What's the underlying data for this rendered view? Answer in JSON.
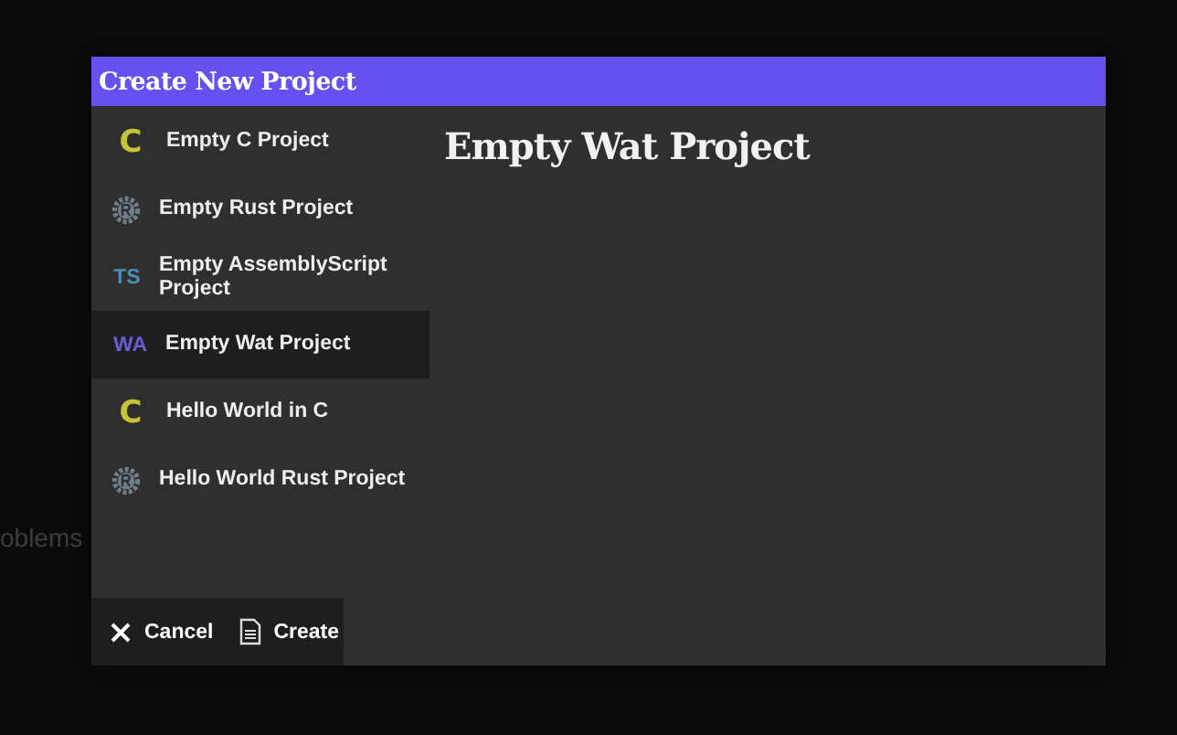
{
  "background": {
    "panel_label": "oblems"
  },
  "dialog": {
    "title": "Create New Project",
    "templates": [
      {
        "kind": "c",
        "badge": "C",
        "label": "Empty C Project",
        "selected": false
      },
      {
        "kind": "rust",
        "label": "Empty Rust Project",
        "selected": false
      },
      {
        "kind": "ts",
        "badge": "TS",
        "label": "Empty AssemblyScript Project",
        "selected": false
      },
      {
        "kind": "wat",
        "badge": "WA",
        "label": "Empty Wat Project",
        "selected": true
      },
      {
        "kind": "c",
        "badge": "C",
        "label": "Hello World in C",
        "selected": false
      },
      {
        "kind": "rust",
        "label": "Hello World Rust Project",
        "selected": false
      }
    ],
    "detail_title": "Empty Wat Project",
    "buttons": [
      {
        "kind": "cancel",
        "label": "Cancel"
      },
      {
        "kind": "create",
        "label": "Create"
      }
    ]
  }
}
